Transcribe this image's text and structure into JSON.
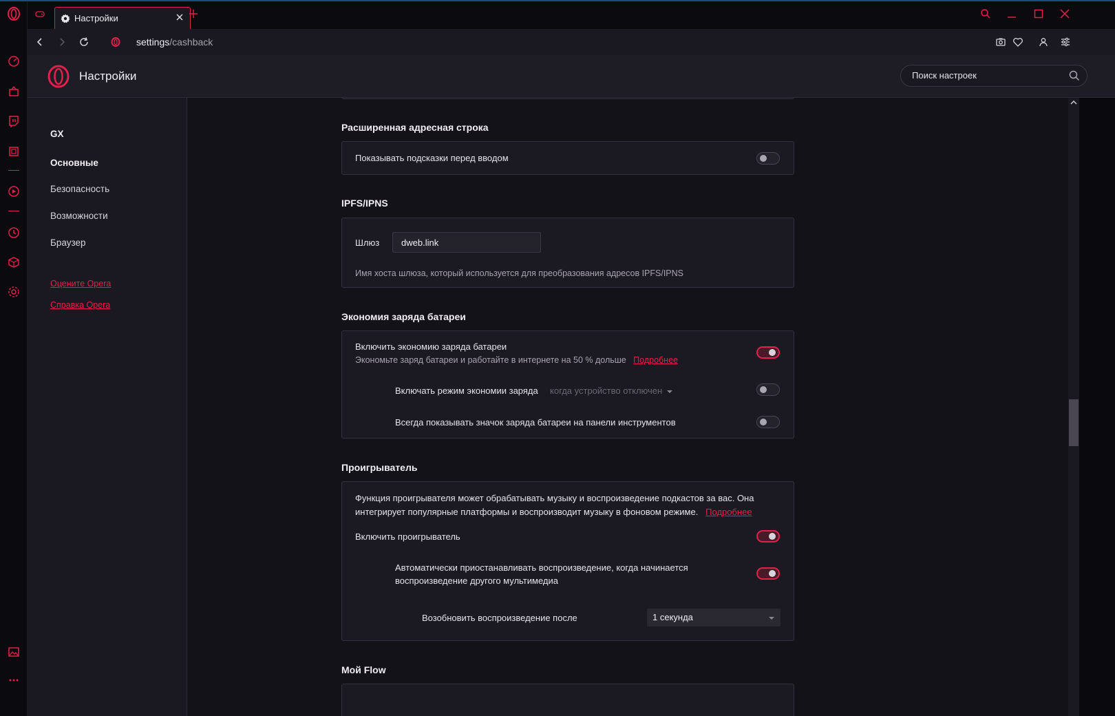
{
  "browser": {
    "tab_title": "Настройки",
    "url_host": "settings",
    "url_path": "/cashback"
  },
  "header": {
    "title": "Настройки",
    "search_placeholder": "Поиск настроек"
  },
  "nav": {
    "items": [
      "GX",
      "Основные",
      "Безопасность",
      "Возможности",
      "Браузер"
    ],
    "links": [
      "Оцените Opera",
      "Справка Opera"
    ]
  },
  "sections": {
    "address_bar": {
      "title": "Расширенная адресная строка",
      "show_hints": "Показывать подсказки перед вводом"
    },
    "ipfs": {
      "title": "IPFS/IPNS",
      "gateway_label": "Шлюз",
      "gateway_value": "dweb.link",
      "gateway_desc": "Имя хоста шлюза, который используется для преобразования адресов IPFS/IPNS"
    },
    "battery": {
      "title": "Экономия заряда батареи",
      "enable_label": "Включить экономию заряда батареи",
      "enable_desc": "Экономьте заряд батареи и работайте в интернете на 50 % дольше",
      "more_link": "Подробнее",
      "mode_label": "Включать режим экономии заряда",
      "mode_select": "когда устройство отключено",
      "show_icon": "Всегда показывать значок заряда батареи на панели инструментов"
    },
    "player": {
      "title": "Проигрыватель",
      "desc_line1": "Функция проигрывателя может обрабатывать музыку и воспроизведение подкастов за вас. Она",
      "desc_line2": "интегрирует популярные платформы и воспроизводит музыку в фоновом режиме.",
      "more_link": "Подробнее",
      "enable_label": "Включить проигрыватель",
      "auto_pause_line1": "Автоматически приостанавливать воспроизведение, когда начинается",
      "auto_pause_line2": "воспроизведение другого мультимедиа",
      "resume_label": "Возобновить воспроизведение после",
      "resume_value": "1 секунда"
    },
    "flow": {
      "title": "Мой Flow"
    }
  },
  "colors": {
    "accent": "#e3204b",
    "background": "#141219",
    "card": "#1b1922"
  }
}
